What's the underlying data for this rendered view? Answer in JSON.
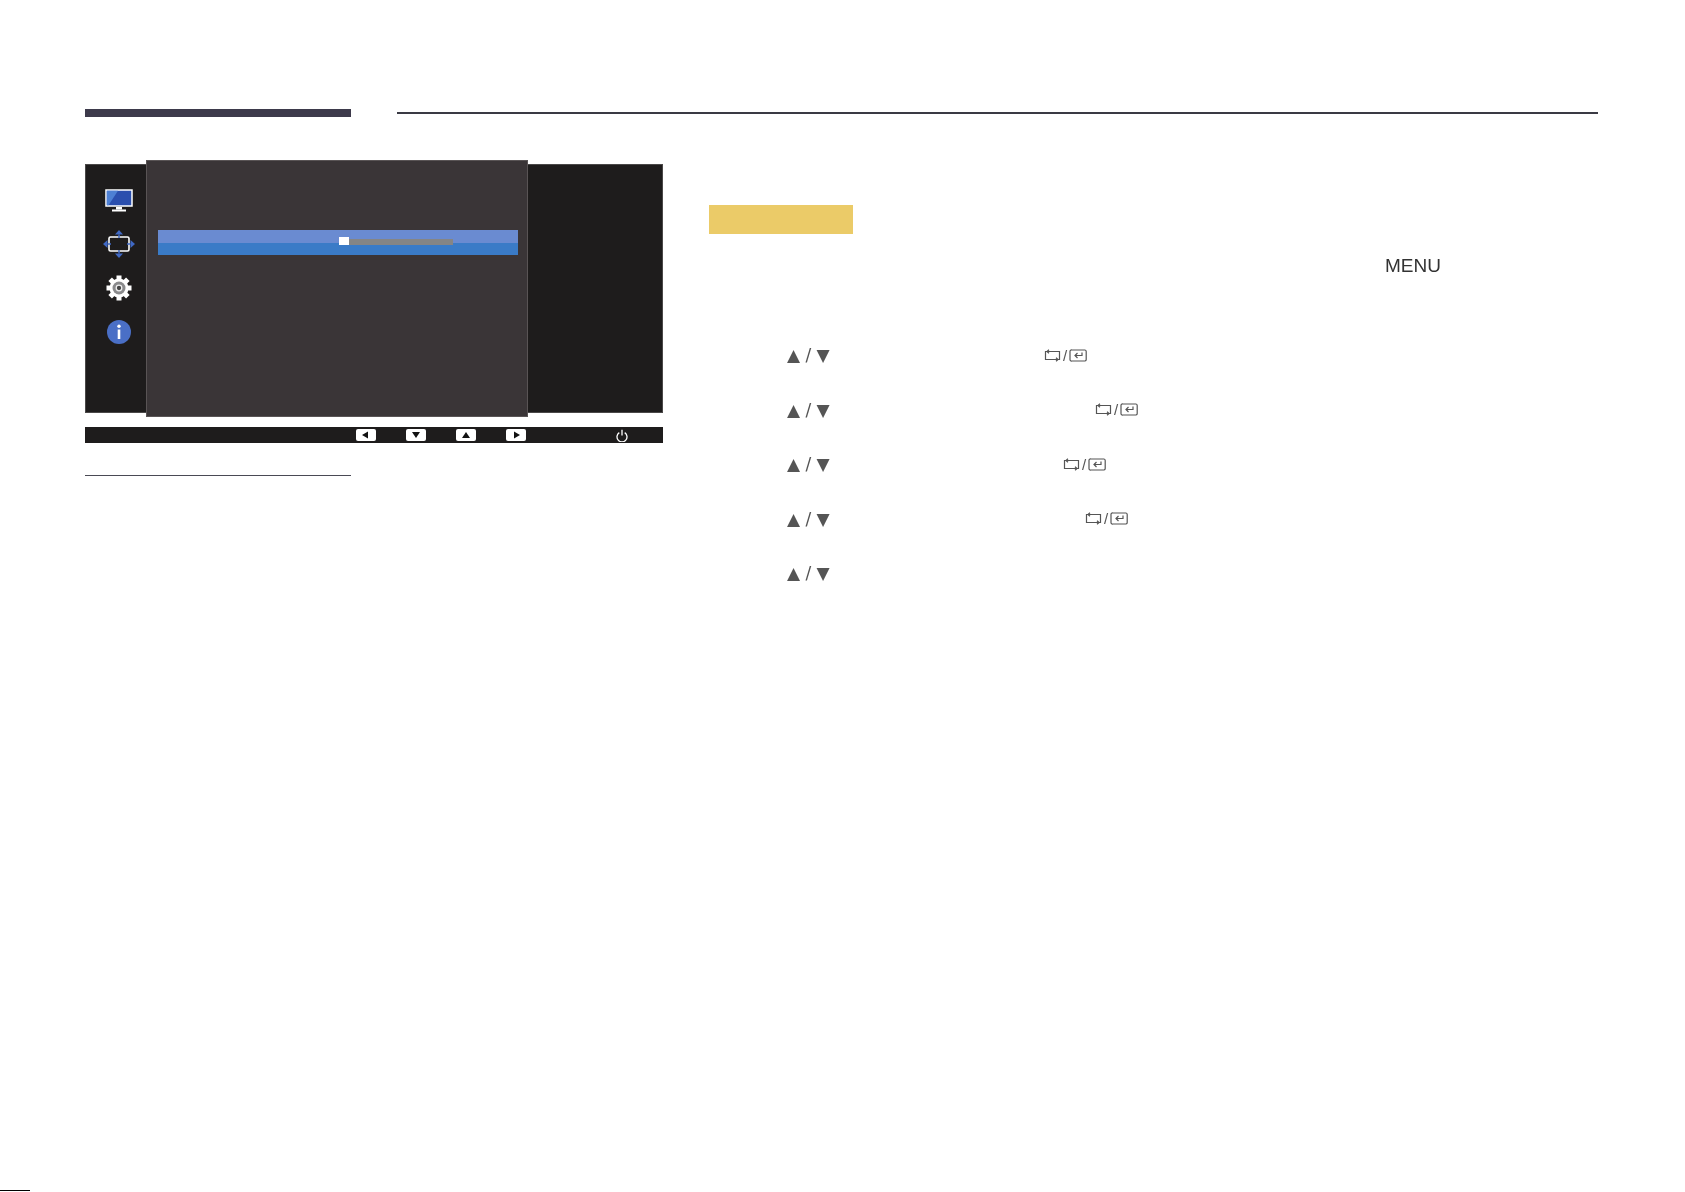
{
  "osd": {
    "sidebar": [
      {
        "kind": "monitor"
      },
      {
        "kind": "arrows"
      },
      {
        "kind": "gear"
      },
      {
        "kind": "info"
      }
    ],
    "menu_rows": [
      {
        "selected": true,
        "level": 0
      }
    ],
    "buttons": [
      {
        "kind": "left"
      },
      {
        "kind": "down"
      },
      {
        "kind": "up"
      },
      {
        "kind": "right"
      },
      {
        "kind": "power"
      }
    ]
  },
  "instructions": {
    "key_label": "MENU",
    "steps": [
      {
        "keys": "▲ / ▼",
        "confirm_separator": "/"
      },
      {
        "keys": "▲ / ▼",
        "confirm_separator": "/"
      },
      {
        "keys": "▲ / ▼",
        "confirm_separator": "/"
      },
      {
        "keys": "▲ / ▼",
        "confirm_separator": "/"
      },
      {
        "keys": "▲ / ▼"
      }
    ]
  }
}
